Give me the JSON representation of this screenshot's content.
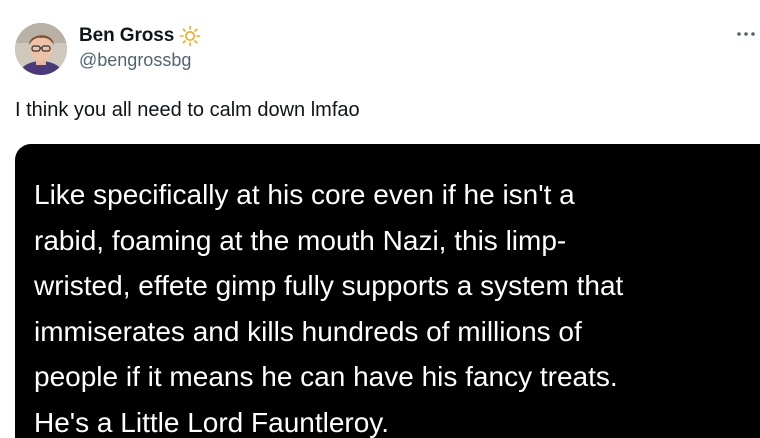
{
  "author": {
    "display_name": "Ben Gross",
    "handle": "@bengrossbg",
    "badge_icon": "sun-icon",
    "badge_color": "#f5a623"
  },
  "menu": {
    "icon": "more-icon"
  },
  "tweet": {
    "text": "I think you all need to calm down lmfao"
  },
  "media": {
    "quote_text": "Like specifically at his core even if he isn't a\nrabid, foaming at the mouth Nazi, this limp-\nwristed, effete gimp fully supports a system that\nimmiserates and kills hundreds of millions of\npeople if it means he can have his fancy treats.\nHe's a Little Lord Fauntleroy.",
    "background": "#000000"
  }
}
